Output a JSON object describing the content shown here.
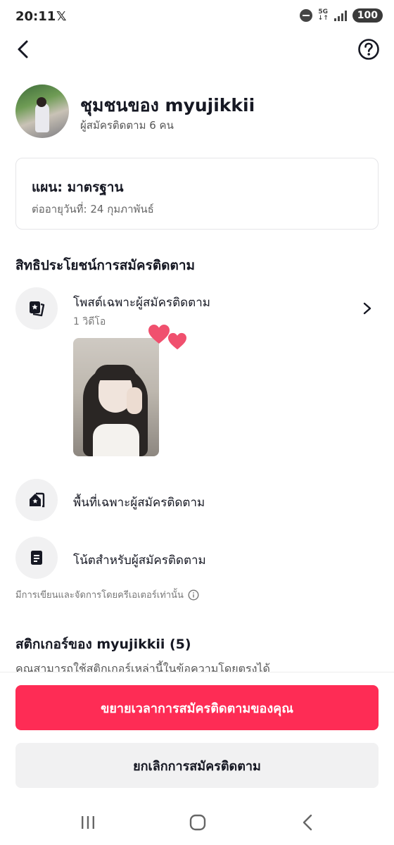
{
  "status_bar": {
    "time": "20:11",
    "app_glyph": "𝕏",
    "network": "5G",
    "battery": "100"
  },
  "header": {
    "back_icon": "back-arrow-icon",
    "help_icon": "question-circle-icon"
  },
  "profile": {
    "name": "ชุมชนของ myujikkii",
    "subscribers": "ผู้สมัครติดตาม 6 คน"
  },
  "plan": {
    "title": "แผน: มาตรฐาน",
    "renewal": "ต่ออายุวันที่: 24 กุมภาพันธ์"
  },
  "benefits": {
    "title": "สิทธิประโยชน์การสมัครติดตาม",
    "items": [
      {
        "label": "โพสต์เฉพาะผู้สมัครติดตาม",
        "sub": "1 วิดีโอ",
        "icon": "exclusive-post-icon"
      },
      {
        "label": "พื้นที่เฉพาะผู้สมัครติดตาม",
        "icon": "exclusive-space-icon"
      },
      {
        "label": "โน้ตสำหรับผู้สมัครติดตาม",
        "icon": "note-icon"
      }
    ],
    "footnote": "มีการเขียนและจัดการโดยครีเอเตอร์เท่านั้น"
  },
  "stickers": {
    "title": "สติกเกอร์ของ myujikkii (5)",
    "subtitle": "คุณสามารถใช้สติกเกอร์เหล่านี้ในข้อความโดยตรงได้"
  },
  "actions": {
    "extend": "ขยายเวลาการสมัครติดตามของคุณ",
    "cancel": "ยกเลิกการสมัครติดตาม"
  },
  "colors": {
    "accent": "#fe2c55",
    "text": "#161823",
    "heart": "#f0506e"
  }
}
